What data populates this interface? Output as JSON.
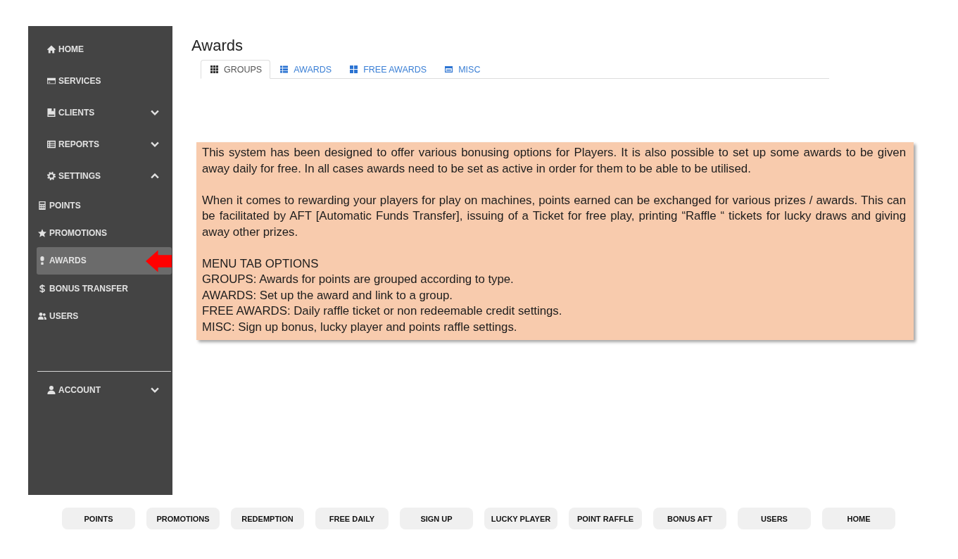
{
  "sidebar": {
    "items": [
      {
        "label": "HOME",
        "selected": false
      },
      {
        "label": "SERVICES",
        "selected": false
      },
      {
        "label": "CLIENTS",
        "selected": false,
        "expanded": false
      },
      {
        "label": "REPORTS",
        "selected": false,
        "expanded": false
      },
      {
        "label": "SETTINGS",
        "selected": false,
        "expanded": true,
        "children": [
          {
            "label": "POINTS",
            "selected": false
          },
          {
            "label": "PROMOTIONS",
            "selected": false
          },
          {
            "label": "AWARDS",
            "selected": true
          },
          {
            "label": "BONUS TRANSFER",
            "selected": false
          },
          {
            "label": "USERS",
            "selected": false
          }
        ]
      }
    ],
    "account": {
      "label": "ACCOUNT",
      "expanded": false
    }
  },
  "page_title": "Awards",
  "tabs": [
    {
      "label": "GROUPS",
      "selected": true
    },
    {
      "label": "AWARDS",
      "selected": false
    },
    {
      "label": "FREE AWARDS",
      "selected": false
    },
    {
      "label": "MISC",
      "selected": false
    }
  ],
  "info_box": {
    "paragraphs": [
      "This system has been designed to offer various bonusing options for Players. It is also possible to set up some awards to be given away daily for free. In all cases awards need to be set as active in order for them to be able to be utilised.",
      "When it comes to rewarding your players for play on machines, points earned can be exchanged for various prizes / awards. This can be facilitated by AFT [Automatic Funds Transfer], issuing of a Ticket for free play, printing “Raffle “ tickets for lucky draws and giving away other prizes."
    ],
    "list_title": "MENU TAB OPTIONS",
    "list": [
      "GROUPS: Awards for points are grouped according to type.",
      "AWARDS: Set up the award and link to a group.",
      "FREE AWARDS: Daily raffle ticket or non redeemable credit settings.",
      "MISC: Sign up bonus, lucky player and points raffle settings."
    ]
  },
  "bottom_buttons": [
    "POINTS",
    "PROMOTIONS",
    "REDEMPTION",
    "FREE DAILY",
    "SIGN UP",
    "LUCKY PLAYER",
    "POINT RAFFLE",
    "BONUS AFT",
    "USERS",
    "HOME"
  ]
}
